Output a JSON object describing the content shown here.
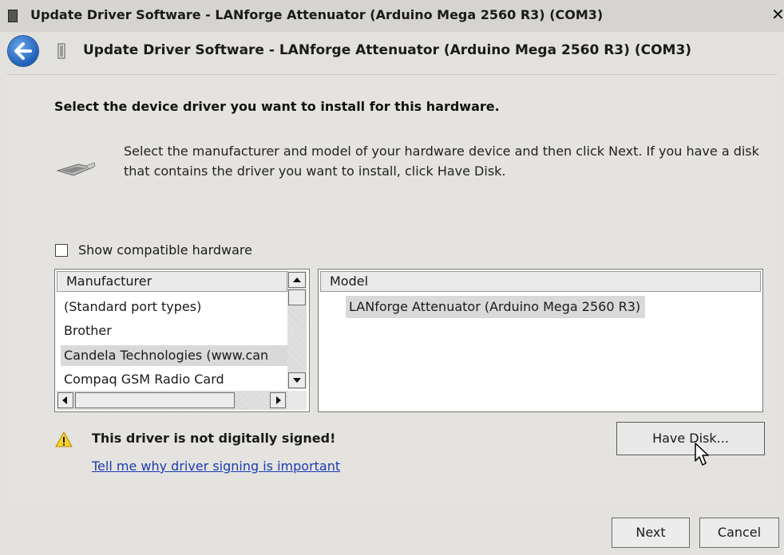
{
  "window": {
    "title": "Update Driver Software - LANforge Attenuator (Arduino Mega 2560 R3) (COM3)",
    "close_glyph": "✕"
  },
  "header": {
    "title": "Update Driver Software - LANforge Attenuator (Arduino Mega 2560 R3) (COM3)",
    "back_icon": "back-arrow-icon"
  },
  "content": {
    "heading": "Select the device driver you want to install for this hardware.",
    "instruction": "Select the manufacturer and model of your hardware device and then click Next. If you have a disk that contains the driver you want to install, click Have Disk.",
    "show_compatible": {
      "label": "Show compatible hardware",
      "checked": false
    },
    "manufacturer_list": {
      "header": "Manufacturer",
      "items": [
        "(Standard port types)",
        "Brother",
        "Candela Technologies (www.can",
        "Compaq GSM Radio Card"
      ],
      "selected_index": 2
    },
    "model_list": {
      "header": "Model",
      "items": [
        "LANforge Attenuator (Arduino Mega 2560 R3)"
      ],
      "selected_index": 0
    },
    "warning": {
      "text": "This driver is not digitally signed!",
      "link": "Tell me why driver signing is important"
    },
    "have_disk_label": "Have Disk..."
  },
  "footer": {
    "next_label": "Next",
    "cancel_label": "Cancel"
  }
}
